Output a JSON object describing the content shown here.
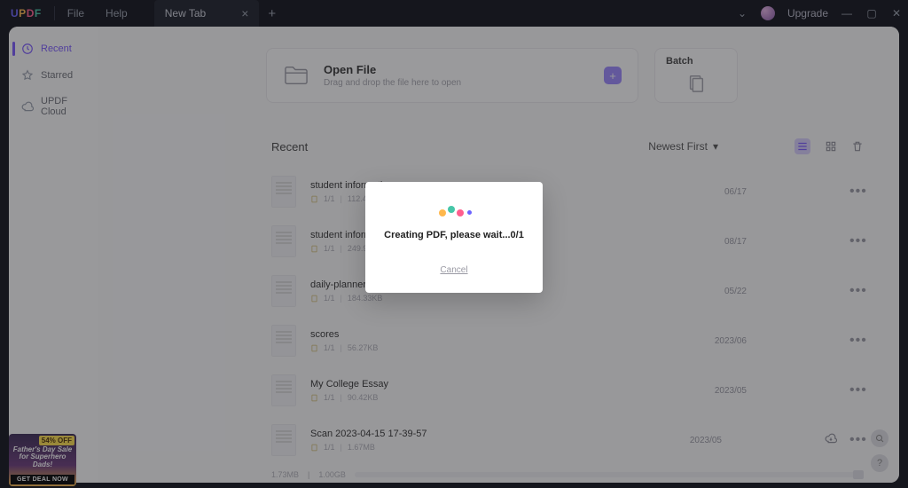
{
  "titlebar": {
    "menu_file": "File",
    "menu_help": "Help",
    "tab_label": "New Tab",
    "upgrade": "Upgrade"
  },
  "sidebar": {
    "items": [
      {
        "label": "Recent"
      },
      {
        "label": "Starred"
      },
      {
        "label": "UPDF Cloud"
      }
    ]
  },
  "open_card": {
    "title": "Open File",
    "subtitle": "Drag and drop the file here to open"
  },
  "batch_card": {
    "title": "Batch"
  },
  "list": {
    "heading": "Recent",
    "sort": "Newest First"
  },
  "files": [
    {
      "name": "student information",
      "pages": "1/1",
      "size": "112.43KB",
      "date": "06/17"
    },
    {
      "name": "student information",
      "pages": "1/1",
      "size": "249.99KB",
      "date": "08/17"
    },
    {
      "name": "daily-planner-03",
      "pages": "1/1",
      "size": "184.33KB",
      "date": "05/22"
    },
    {
      "name": "scores",
      "pages": "1/1",
      "size": "56.27KB",
      "date": "2023/06"
    },
    {
      "name": "My College Essay",
      "pages": "1/1",
      "size": "90.42KB",
      "date": "2023/05"
    },
    {
      "name": "Scan 2023-04-15 17-39-57",
      "pages": "1/1",
      "size": "1.67MB",
      "date": "2023/05",
      "cloud": true
    }
  ],
  "status": {
    "used": "1.73MB",
    "total": "1.00GB"
  },
  "promo": {
    "discount": "54% OFF",
    "headline": "Father's Day Sale for Superhero Dads!",
    "cta": "GET DEAL NOW"
  },
  "modal": {
    "message": "Creating PDF, please wait...0/1",
    "cancel": "Cancel"
  }
}
